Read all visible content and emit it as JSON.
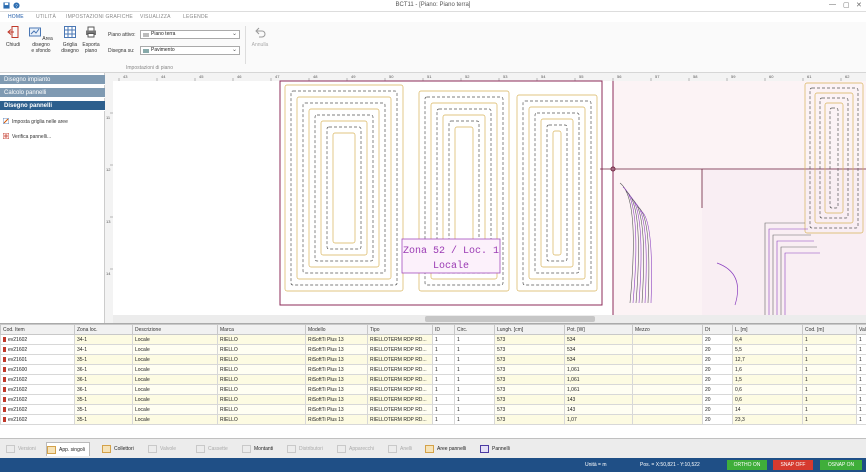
{
  "window": {
    "title": "BCT11 - [Piano: Piano terra]",
    "controls": [
      "—",
      "▢",
      "✕"
    ]
  },
  "ribbon_tabs": [
    "HOME",
    "UTILITÀ",
    "IMPOSTAZIONI GRAFICHE",
    "VISUALIZZA",
    "LEGENDE"
  ],
  "ribbon": {
    "close_label": "Chiudi",
    "area_label": "Area disegno\ne sfondo",
    "griglia_label": "Griglia\ndisegno",
    "esporta_label": "Esporta\npiano",
    "piano_attivo_label": "Piano attivo:",
    "piano_attivo_value": "Piano terra",
    "disegna_su_label": "Disegna su:",
    "disegna_su_value": "Pavimento",
    "annulla_label": "Annulla",
    "group_label": "Impostazioni di piano"
  },
  "left_panel": {
    "sections": [
      "Disegno impianto",
      "Calcolo pannelli",
      "Disegno pannelli"
    ],
    "commands": [
      "Imposta griglia nelle aree",
      "Verifica pannelli..."
    ]
  },
  "ruler": {
    "top": [
      "43",
      "44",
      "45",
      "46",
      "47",
      "48",
      "49",
      "50",
      "51",
      "52",
      "53",
      "54",
      "55",
      "56",
      "57",
      "58",
      "59",
      "60",
      "61",
      "62"
    ],
    "left": [
      "11",
      "12",
      "13",
      "14"
    ]
  },
  "drawing": {
    "zone_label_line1": "Zona 52 / Loc. 1",
    "zone_label_line2": "Locale"
  },
  "grid": {
    "columns": [
      "Cod. Item",
      "Zona loc.",
      "Descrizione",
      "Marca",
      "Modello",
      "Tipo",
      "ID",
      "Circ.",
      "Lungh. [cm]",
      "Pot. [W]",
      "Mezzo",
      "Dt",
      "L. [m]",
      "Cod. [m]",
      "Val."
    ],
    "rows": [
      [
        "ev21602",
        "34-1",
        "Locale",
        "RIELLO",
        "RiSoftTi Plus 13",
        "RIELLOTERM RDP RD...",
        "1",
        "1",
        "573",
        "534",
        "",
        "20",
        "6,4",
        "1",
        "1"
      ],
      [
        "ev21602",
        "34-1",
        "Locale",
        "RIELLO",
        "RiSoftTi Plus 13",
        "RIELLOTERM RDP RD...",
        "1",
        "1",
        "573",
        "534",
        "",
        "20",
        "5,5",
        "1",
        "1"
      ],
      [
        "ev21601",
        "35-1",
        "Locale",
        "RIELLO",
        "RiSoftTi Plus 13",
        "RIELLOTERM RDP RD...",
        "1",
        "1",
        "573",
        "534",
        "",
        "20",
        "12,7",
        "1",
        "1"
      ],
      [
        "ev21600",
        "36-1",
        "Locale",
        "RIELLO",
        "RiSoftTi Plus 13",
        "RIELLOTERM RDP RD...",
        "1",
        "1",
        "573",
        "1,061",
        "",
        "20",
        "1,6",
        "1",
        "1"
      ],
      [
        "ev21602",
        "36-1",
        "Locale",
        "RIELLO",
        "RiSoftTi Plus 13",
        "RIELLOTERM RDP RD...",
        "1",
        "1",
        "573",
        "1,061",
        "",
        "20",
        "1,5",
        "1",
        "1"
      ],
      [
        "ev21602",
        "36-1",
        "Locale",
        "RIELLO",
        "RiSoftTi Plus 13",
        "RIELLOTERM RDP RD...",
        "1",
        "1",
        "573",
        "1,061",
        "",
        "20",
        "0,6",
        "1",
        "1"
      ],
      [
        "ev21602",
        "35-1",
        "Locale",
        "RIELLO",
        "RiSoftTi Plus 13",
        "RIELLOTERM RDP RD...",
        "1",
        "1",
        "573",
        "143",
        "",
        "20",
        "0,6",
        "1",
        "1"
      ],
      [
        "ev21602",
        "35-1",
        "Locale",
        "RIELLO",
        "RiSoftTi Plus 13",
        "RIELLOTERM RDP RD...",
        "1",
        "1",
        "573",
        "143",
        "",
        "20",
        "14",
        "1",
        "1"
      ],
      [
        "ev21602",
        "35-1",
        "Locale",
        "RIELLO",
        "RiSoftTi Plus 13",
        "RIELLOTERM RDP RD...",
        "1",
        "1",
        "573",
        "1,07",
        "",
        "20",
        "23,3",
        "1",
        "1"
      ]
    ]
  },
  "bottom_tabs": [
    "Versioni",
    "App. singoli",
    "Collettori",
    "Valvole",
    "Cassette",
    "Montanti",
    "Distributori",
    "Apparecchi",
    "Anelli",
    "Aree pannelli",
    "Pannelli"
  ],
  "status": {
    "units": "Unità = m",
    "position": "Pos. = X:50,821 - Y:10,522",
    "ortho": "ORTHO ON",
    "snap": "SNAP OFF",
    "osnap": "OSNAP ON"
  },
  "colors": {
    "accent": "#1e5aa8",
    "status_bar": "#1f4f86",
    "ortho": "#3fae3a",
    "snap": "#d63a2f",
    "osnap": "#3fae3a",
    "selected_section": "#2d5f8d"
  }
}
